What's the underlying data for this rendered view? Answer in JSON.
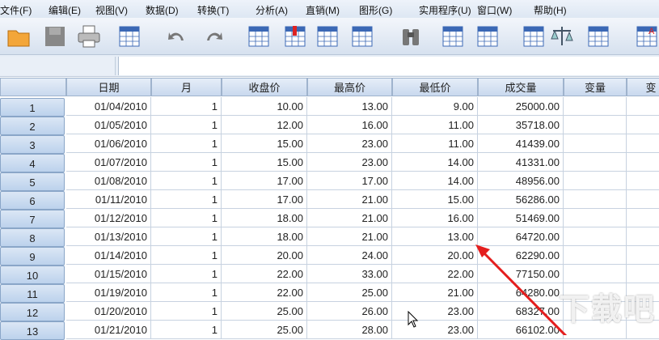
{
  "menu": [
    "文件(F)",
    "编辑(E)",
    "视图(V)",
    "数据(D)",
    "转换(T)",
    "分析(A)",
    "直销(M)",
    "图形(G)",
    "实用程序(U)",
    "窗口(W)",
    "帮助(H)"
  ],
  "toolbar": [
    "open-icon",
    "save-icon",
    "print-icon",
    "recall-dialog-icon",
    "undo-icon",
    "redo-icon",
    "goto-case-icon",
    "goto-variable-icon",
    "variables-icon",
    "run-descriptives-icon",
    "find-icon",
    "insert-cases-icon",
    "insert-variable-icon",
    "split-file-icon",
    "weight-cases-icon",
    "select-cases-icon",
    "value-labels-icon"
  ],
  "columns": [
    "日期",
    "月",
    "收盘价",
    "最高价",
    "最低价",
    "成交量",
    "变量",
    "变"
  ],
  "rows": [
    [
      "1",
      "01/04/2010",
      "1",
      "10.00",
      "13.00",
      "9.00",
      "25000.00"
    ],
    [
      "2",
      "01/05/2010",
      "1",
      "12.00",
      "16.00",
      "11.00",
      "35718.00"
    ],
    [
      "3",
      "01/06/2010",
      "1",
      "15.00",
      "23.00",
      "11.00",
      "41439.00"
    ],
    [
      "4",
      "01/07/2010",
      "1",
      "15.00",
      "23.00",
      "14.00",
      "41331.00"
    ],
    [
      "5",
      "01/08/2010",
      "1",
      "17.00",
      "17.00",
      "14.00",
      "48956.00"
    ],
    [
      "6",
      "01/11/2010",
      "1",
      "17.00",
      "21.00",
      "15.00",
      "56286.00"
    ],
    [
      "7",
      "01/12/2010",
      "1",
      "18.00",
      "21.00",
      "16.00",
      "51469.00"
    ],
    [
      "8",
      "01/13/2010",
      "1",
      "18.00",
      "21.00",
      "13.00",
      "64720.00"
    ],
    [
      "9",
      "01/14/2010",
      "1",
      "20.00",
      "24.00",
      "20.00",
      "62290.00"
    ],
    [
      "10",
      "01/15/2010",
      "1",
      "22.00",
      "33.00",
      "22.00",
      "77150.00"
    ],
    [
      "11",
      "01/19/2010",
      "1",
      "22.00",
      "25.00",
      "21.00",
      "64280.00"
    ],
    [
      "12",
      "01/20/2010",
      "1",
      "25.00",
      "26.00",
      "23.00",
      "68327.00"
    ],
    [
      "13",
      "01/21/2010",
      "1",
      "25.00",
      "28.00",
      "23.00",
      "66102.00"
    ]
  ],
  "watermark": "下载吧",
  "colors": {
    "accent": "#e02020",
    "header": "#c9d9ee"
  }
}
